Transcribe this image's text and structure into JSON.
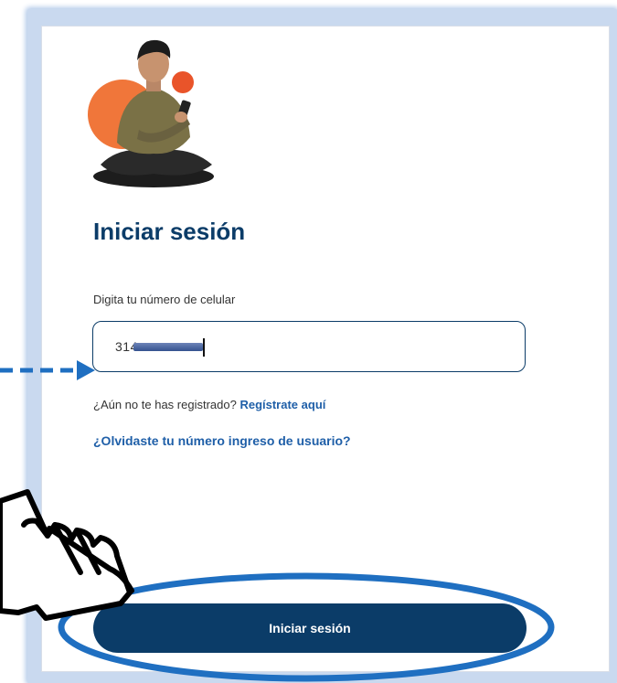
{
  "login": {
    "title": "Iniciar sesión",
    "phone_label": "Digita tu número de celular",
    "phone_value": "314",
    "register_prompt": "¿Aún no te has registrado?",
    "register_link": "Regístrate aquí",
    "forgot_link": "¿Olvidaste tu número ingreso de usuario?",
    "submit_label": "Iniciar sesión"
  },
  "icons": {
    "illustration": "person-sitting-with-phone-illustration",
    "pointer_hand": "pointing-hand-icon",
    "arrow": "dashed-arrow-icon"
  },
  "colors": {
    "primary": "#0b3c68",
    "link": "#1f5fa8",
    "annotation": "#1f6fc1",
    "accent_orange": "#f0763a"
  }
}
